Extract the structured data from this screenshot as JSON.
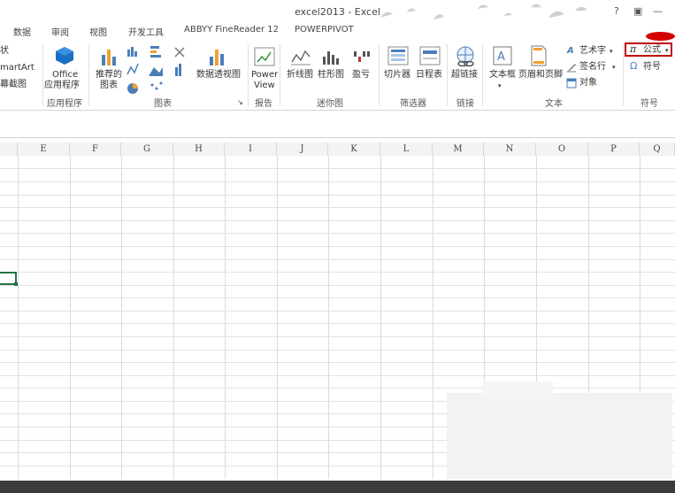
{
  "window": {
    "title": "excel2013 - Excel",
    "help": "?",
    "restore": "▣",
    "minimize": "—"
  },
  "tabs": [
    "数据",
    "审阅",
    "视图",
    "开发工具",
    "ABBYY FineReader 12",
    "POWERPIVOT"
  ],
  "ribbon": {
    "left_partial": {
      "shapes": "状",
      "smartart": "martArt",
      "screenshot": "幕截图"
    },
    "apps": {
      "office_line1": "Office",
      "office_line2": "应用程序",
      "group": "应用程序"
    },
    "charts": {
      "recommended_line1": "推荐的",
      "recommended_line2": "图表",
      "pivot_chart": "数据透视图",
      "group": "图表"
    },
    "reports": {
      "power_line1": "Power",
      "power_line2": "View",
      "group": "报告"
    },
    "sparklines": {
      "line": "折线图",
      "column": "柱形图",
      "winloss": "盈亏",
      "group": "迷你图"
    },
    "filters": {
      "slicer": "切片器",
      "timeline": "日程表",
      "group": "筛选器"
    },
    "links": {
      "hyperlink": "超链接",
      "group": "链接"
    },
    "text": {
      "textbox": "文本框",
      "header_footer": "页眉和页脚",
      "wordart": "艺术字",
      "signature": "签名行",
      "object": "对象",
      "group": "文本"
    },
    "symbols": {
      "equation": "公式",
      "symbol": "符号",
      "group": "符号"
    }
  },
  "columns": [
    "E",
    "F",
    "G",
    "H",
    "I",
    "J",
    "K",
    "L",
    "M",
    "N",
    "O",
    "P",
    "Q"
  ],
  "colors": {
    "accent": "#217346",
    "highlight": "#c00000"
  },
  "icons": [
    "office-store-icon",
    "recommended-charts-icon",
    "pivot-chart-icon",
    "power-view-icon",
    "sparkline-line-icon",
    "sparkline-column-icon",
    "sparkline-winloss-icon",
    "slicer-icon",
    "timeline-icon",
    "hyperlink-icon",
    "textbox-icon",
    "header-footer-icon",
    "wordart-icon",
    "signature-icon",
    "object-icon",
    "pi-icon",
    "omega-icon"
  ]
}
